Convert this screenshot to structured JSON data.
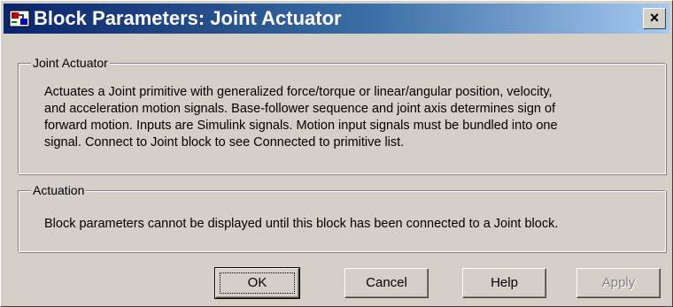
{
  "window": {
    "title": "Block Parameters: Joint Actuator",
    "close_glyph": "×"
  },
  "icons": {
    "app": "simulink-block-icon",
    "close": "close-icon"
  },
  "description_group": {
    "label": "Joint Actuator",
    "lines": [
      "Actuates a Joint primitive with generalized force/torque or linear/angular position, velocity,",
      "and acceleration motion signals. Base-follower sequence and joint axis determines sign of",
      "forward motion. Inputs are Simulink signals. Motion input signals must be bundled into one",
      "signal. Connect to Joint block to see Connected to primitive list."
    ]
  },
  "actuation_group": {
    "label": "Actuation",
    "message": "Block parameters cannot be displayed until this block has been connected to a Joint block."
  },
  "buttons": {
    "ok": "OK",
    "cancel": "Cancel",
    "help": "Help",
    "apply": "Apply"
  },
  "colors": {
    "dialog_bg": "#d4d0c8",
    "title_gradient_start": "#0a246a",
    "title_gradient_end": "#a6caf0",
    "disabled_text": "#808080"
  }
}
